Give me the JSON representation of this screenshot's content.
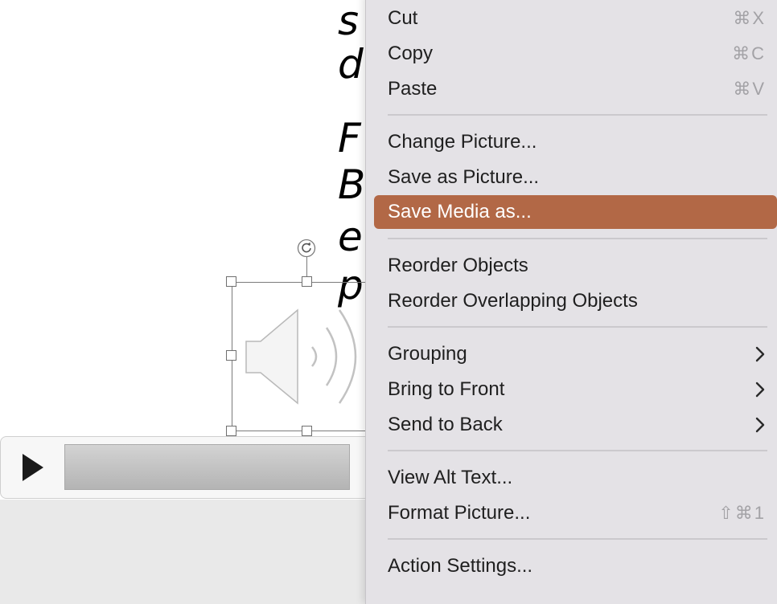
{
  "slide": {
    "text_lines": [
      "s",
      "d",
      "F",
      "B",
      "e",
      "p"
    ]
  },
  "icons": {
    "speaker": "speaker-icon",
    "rotate": "rotate-handle-icon",
    "play": "play-icon",
    "submenu": "chevron-right-icon"
  },
  "colors": {
    "highlight": "#b26846",
    "menu_bg": "#e4e2e6",
    "shortcut_text": "#a3a2a6"
  },
  "menu": {
    "cut": {
      "label": "Cut",
      "shortcut": "⌘X"
    },
    "copy": {
      "label": "Copy",
      "shortcut": "⌘C"
    },
    "paste": {
      "label": "Paste",
      "shortcut": "⌘V"
    },
    "change_picture": {
      "label": "Change Picture..."
    },
    "save_as_picture": {
      "label": "Save as Picture..."
    },
    "save_media_as": {
      "label": "Save Media as..."
    },
    "reorder_objects": {
      "label": "Reorder Objects"
    },
    "reorder_overlapping": {
      "label": "Reorder Overlapping Objects"
    },
    "grouping": {
      "label": "Grouping"
    },
    "bring_to_front": {
      "label": "Bring to Front"
    },
    "send_to_back": {
      "label": "Send to Back"
    },
    "view_alt_text": {
      "label": "View Alt Text..."
    },
    "format_picture": {
      "label": "Format Picture...",
      "shortcut": "⇧⌘1"
    },
    "action_settings": {
      "label": "Action Settings..."
    }
  }
}
